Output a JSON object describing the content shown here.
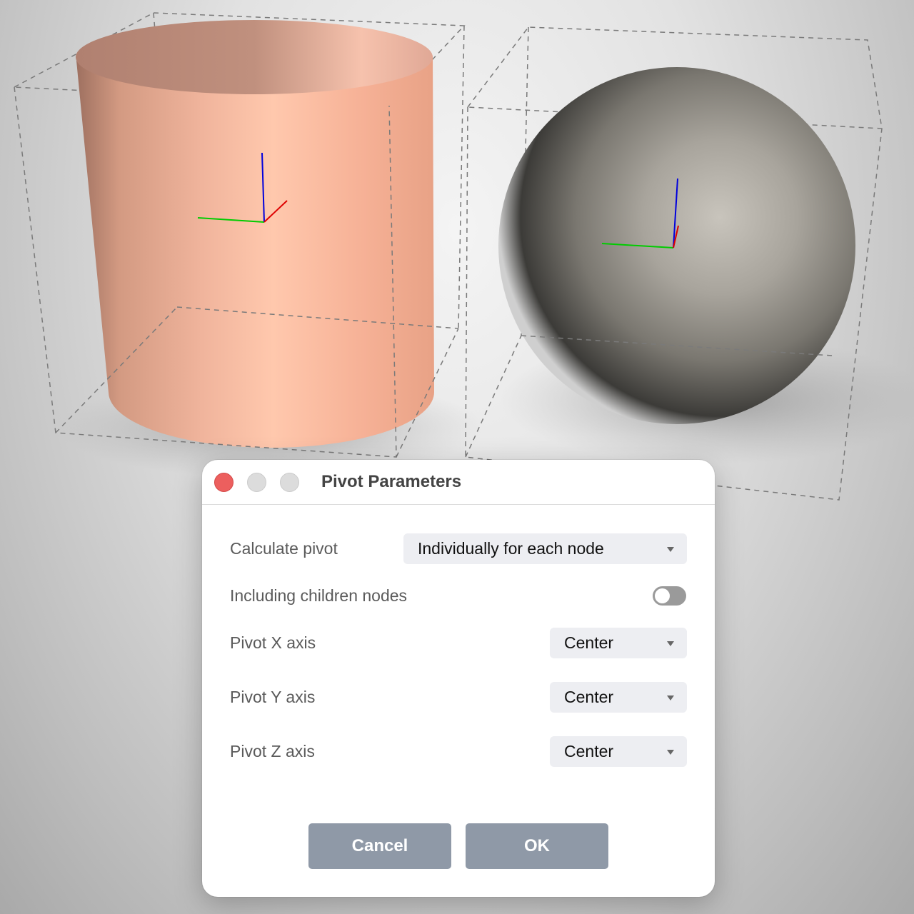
{
  "dialog": {
    "title": "Pivot Parameters",
    "window_controls": [
      "close",
      "minimize",
      "maximize"
    ],
    "rows": {
      "calculate_pivot": {
        "label": "Calculate pivot",
        "value": "Individually for each node"
      },
      "including_children": {
        "label": "Including children nodes",
        "enabled": false
      },
      "pivot_x": {
        "label": "Pivot X axis",
        "value": "Center"
      },
      "pivot_y": {
        "label": "Pivot Y axis",
        "value": "Center"
      },
      "pivot_z": {
        "label": "Pivot Z axis",
        "value": "Center"
      }
    },
    "buttons": {
      "cancel": "Cancel",
      "ok": "OK"
    }
  },
  "scene": {
    "objects": [
      "cylinder",
      "sphere"
    ],
    "colors": {
      "cylinder": "#f4b49a",
      "sphere": "#9c9890",
      "axis_x": "#dd0000",
      "axis_y": "#00cc00",
      "axis_z": "#0000dd",
      "close_button": "#ec5f5e",
      "button_bg": "#8f99a7"
    }
  }
}
